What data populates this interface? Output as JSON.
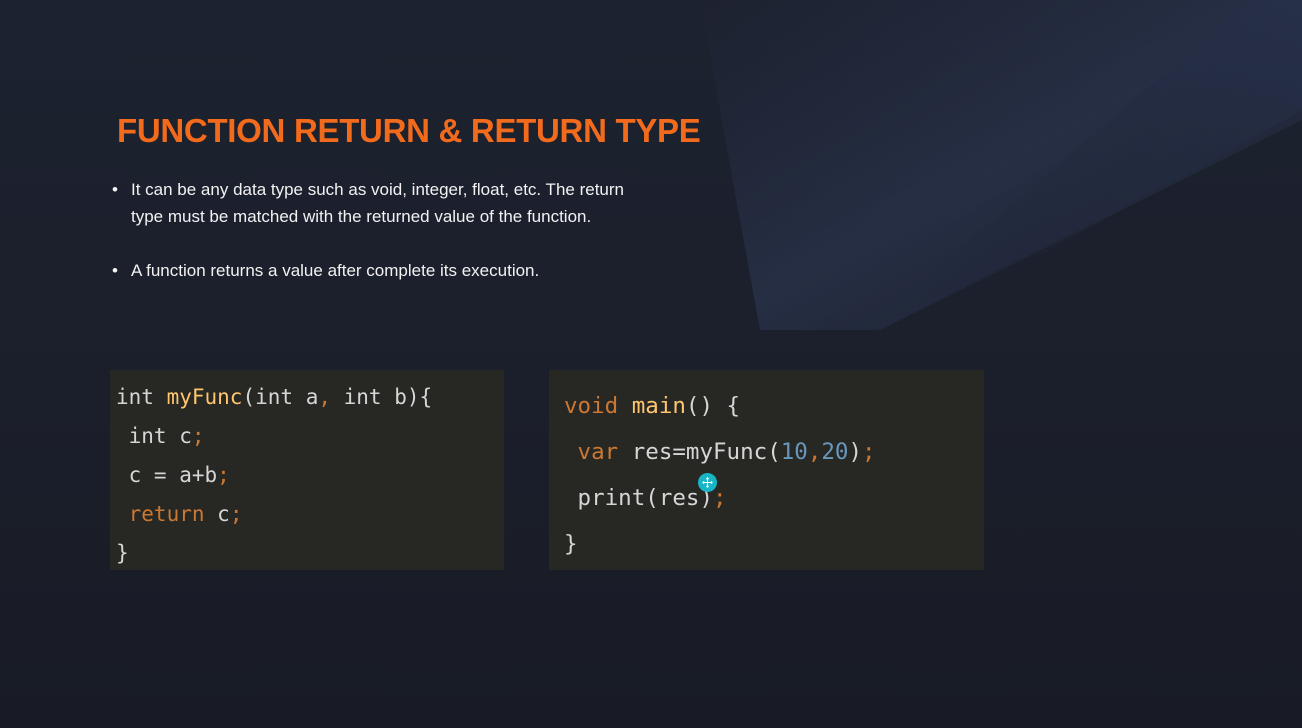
{
  "slide": {
    "title": "FUNCTION RETURN & RETURN TYPE",
    "title_color": "#f26b1d",
    "bullets": [
      "It can be any data type such as void, integer, float, etc. The return type must be matched with the returned value of the function.",
      "A function returns a value after complete its execution."
    ]
  },
  "code_left": {
    "lines": [
      [
        {
          "t": "int",
          "k": "plain"
        },
        {
          "t": " ",
          "k": "plain"
        },
        {
          "t": "myFunc",
          "k": "fn"
        },
        {
          "t": "(",
          "k": "plain"
        },
        {
          "t": "int",
          "k": "plain"
        },
        {
          "t": " a",
          "k": "plain"
        },
        {
          "t": ",",
          "k": "punc"
        },
        {
          "t": " int b){",
          "k": "plain"
        }
      ],
      [
        {
          "t": " int",
          "k": "plain"
        },
        {
          "t": " c",
          "k": "plain"
        },
        {
          "t": ";",
          "k": "punc"
        }
      ],
      [
        {
          "t": " c = a+b",
          "k": "plain"
        },
        {
          "t": ";",
          "k": "punc"
        }
      ],
      [
        {
          "t": " return",
          "k": "kw"
        },
        {
          "t": " c",
          "k": "plain"
        },
        {
          "t": ";",
          "k": "punc"
        }
      ],
      [
        {
          "t": "}",
          "k": "plain"
        }
      ]
    ]
  },
  "code_right": {
    "lines": [
      [
        {
          "t": "void",
          "k": "kw"
        },
        {
          "t": " ",
          "k": "plain"
        },
        {
          "t": "main",
          "k": "fn"
        },
        {
          "t": "() {",
          "k": "plain"
        }
      ],
      [
        {
          "t": " var",
          "k": "kw"
        },
        {
          "t": " res=myFunc(",
          "k": "plain"
        },
        {
          "t": "10",
          "k": "num"
        },
        {
          "t": ",",
          "k": "punc"
        },
        {
          "t": "20",
          "k": "num"
        },
        {
          "t": ")",
          "k": "plain"
        },
        {
          "t": ";",
          "k": "punc"
        }
      ],
      [
        {
          "t": " print(res)",
          "k": "plain"
        },
        {
          "t": ";",
          "k": "punc"
        }
      ],
      [
        {
          "t": "}",
          "k": "plain"
        }
      ]
    ]
  },
  "cursor": {
    "icon": "cursor-move-icon",
    "color": "#16b6c7"
  }
}
